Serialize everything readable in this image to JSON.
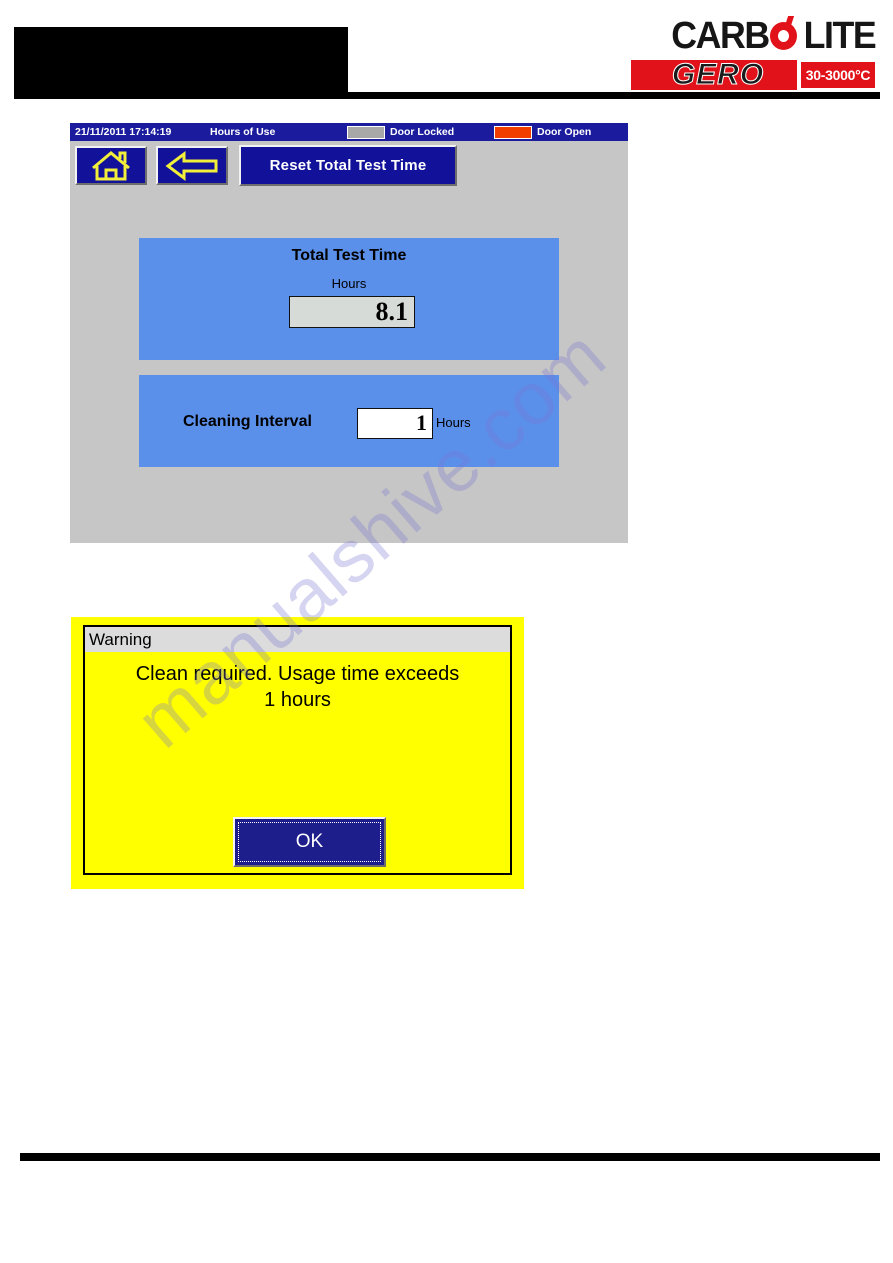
{
  "brand": {
    "name_top": "CARBOLITE",
    "name_top_part1": "CARB",
    "name_top_part2": "LITE",
    "name_bottom": "GERO",
    "temp_badge": "30-3000°C",
    "accent_red": "#e1121a"
  },
  "hmi": {
    "status_bar": {
      "datetime": "21/11/2011 17:14:19",
      "screen_title": "Hours of Use",
      "door_locked_label": "Door Locked",
      "door_locked_color": "#a8a8a8",
      "door_open_label": "Door Open",
      "door_open_color": "#f23d00"
    },
    "toolbar": {
      "home_button_name": "home-icon",
      "back_button_name": "back-arrow-icon",
      "reset_button_label": "Reset Total Test Time"
    },
    "total_test_time_panel": {
      "title": "Total Test Time",
      "units_label": "Hours",
      "value": "8.1"
    },
    "cleaning_interval_panel": {
      "label": "Cleaning Interval",
      "value": "1",
      "units_label": "Hours"
    },
    "panel_color": "#5b90ea",
    "screen_background": "#c6c6c6",
    "button_color": "#11119a"
  },
  "warning_dialog": {
    "title": "Warning",
    "message_line1": "Clean required. Usage time exceeds",
    "message_line2": "1 hours",
    "ok_button_label": "OK",
    "background_color": "#ffff00",
    "button_color": "#1d1d8c"
  },
  "watermark": {
    "text": "manualshive.com"
  }
}
